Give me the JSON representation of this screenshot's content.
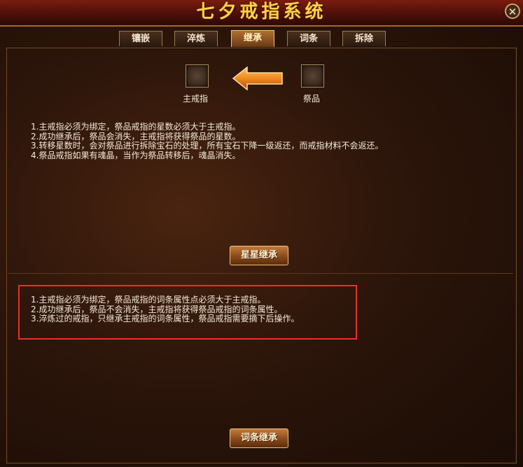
{
  "window": {
    "title": "七夕戒指系统",
    "close_symbol": "✕"
  },
  "tabs": [
    {
      "label": "镶嵌",
      "active": false
    },
    {
      "label": "淬炼",
      "active": false
    },
    {
      "label": "继承",
      "active": true
    },
    {
      "label": "词条",
      "active": false
    },
    {
      "label": "拆除",
      "active": false
    }
  ],
  "slots": {
    "main_label": "主戒指",
    "sacrifice_label": "祭品"
  },
  "star_section": {
    "rules": [
      "1.主戒指必须为绑定，祭品戒指的星数必须大于主戒指。",
      "2.成功继承后，祭品会消失，主戒指将获得祭品的星数。",
      "3.转移星数时，会对祭品进行拆除宝石的处理，所有宝石下降一级返还，而戒指材料不会返还。",
      "4.祭品戒指如果有魂晶，当作为祭品转移后，魂晶消失。"
    ],
    "button_label": "星星继承"
  },
  "affix_section": {
    "rules": [
      "1.主戒指必须为绑定，祭品戒指的词条属性点必须大于主戒指。",
      "2.成功继承后，祭品不会消失，主戒指将获得祭品戒指的词条属性。",
      "3.淬炼过的戒指，只继承主戒指的词条属性，祭品戒指需要摘下后操作。"
    ],
    "button_label": "词条继承"
  },
  "colors": {
    "title": "#ffd24a",
    "highlight_box": "#e8302a",
    "arrow": "#f08a20"
  },
  "icons": [
    "close-icon",
    "left-arrow-icon"
  ]
}
